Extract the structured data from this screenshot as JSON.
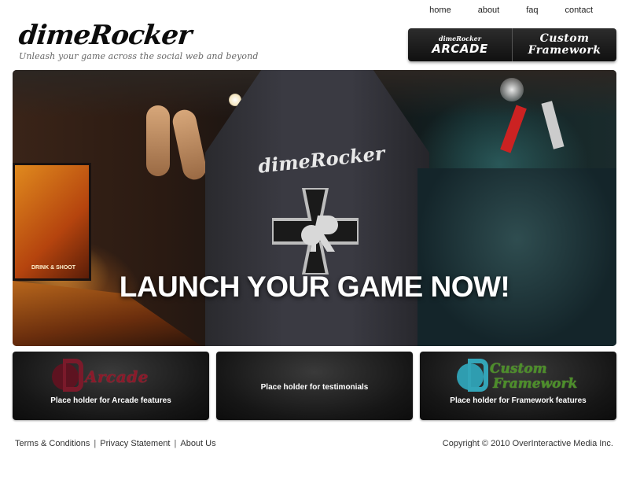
{
  "nav": {
    "items": [
      {
        "label": "home"
      },
      {
        "label": "about"
      },
      {
        "label": "faq"
      },
      {
        "label": "contact"
      }
    ]
  },
  "brand": {
    "name": "dimeRocker",
    "tagline": "Unleash your game across the social web and beyond"
  },
  "switcher": {
    "arcade_small": "dimeRocker",
    "arcade_big": "ARCADE",
    "custom_line1": "Custom",
    "custom_line2": "Framework"
  },
  "hero": {
    "headline": "LAUNCH YOUR GAME NOW!",
    "jacket_brand": "dimeRocker",
    "pinball_label": "DRINK & SHOOT"
  },
  "features": [
    {
      "logo_text": "Arcade",
      "text": "Place holder for Arcade features"
    },
    {
      "text": "Place holder for testimonials"
    },
    {
      "logo_text_1": "Custom",
      "logo_text_2": "Framework",
      "text": "Place holder for Framework features"
    }
  ],
  "footer": {
    "links": [
      {
        "label": "Terms & Conditions"
      },
      {
        "label": "Privacy Statement"
      },
      {
        "label": "About Us"
      }
    ],
    "separator": "|",
    "copyright": "Copyright © 2010 OverInteractive Media Inc."
  },
  "colors": {
    "arcade_accent": "#8a1a2a",
    "framework_accent_blue": "#2f9db0",
    "framework_accent_green": "#4c8e2a",
    "box_bg": "#161616"
  }
}
